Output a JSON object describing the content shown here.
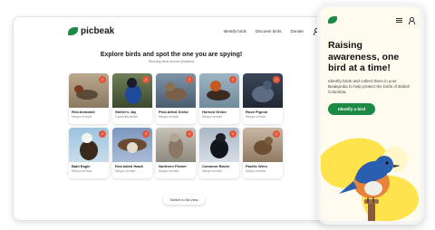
{
  "desktop": {
    "brand": "picbeak",
    "nav": [
      "Identify birds",
      "Discover birds",
      "Donate"
    ],
    "title": "Explore birds and spot the one you are spying!",
    "subtitle": "Showing birds around {location}",
    "birds": [
      {
        "name": "Red-breasted",
        "caption": "Mergus serrator"
      },
      {
        "name": "Steller's Jay",
        "caption": "Cyanocitta stelleri"
      },
      {
        "name": "Pied-billed Grebe",
        "caption": "Mergus serrator"
      },
      {
        "name": "Horned Grebe",
        "caption": "Mergus serrator"
      },
      {
        "name": "Rock Pigeon",
        "caption": "Mergus serrator"
      },
      {
        "name": "Bald Eagle",
        "caption": "Mergus serrator"
      },
      {
        "name": "Red-tailed Hawk",
        "caption": "Mergus serrator"
      },
      {
        "name": "Northern Flicker",
        "caption": "Mergus serrator"
      },
      {
        "name": "Common Raven",
        "caption": "Mergus serrator"
      },
      {
        "name": "Pacific Wren",
        "caption": "Mergus serrator"
      }
    ],
    "switch_label": "Switch to list view"
  },
  "phone": {
    "headline": "Raising awareness, one bird at a time!",
    "body": "Identify birds and collect them in your Beakpedia to help protect the birds of British Columbia.",
    "cta": "Identify a bird"
  },
  "colors": {
    "brand_green": "#1c8a45",
    "badge_red": "#e2573b",
    "phone_bg": "#fffcef",
    "accent_yellow": "#ffe34d"
  }
}
